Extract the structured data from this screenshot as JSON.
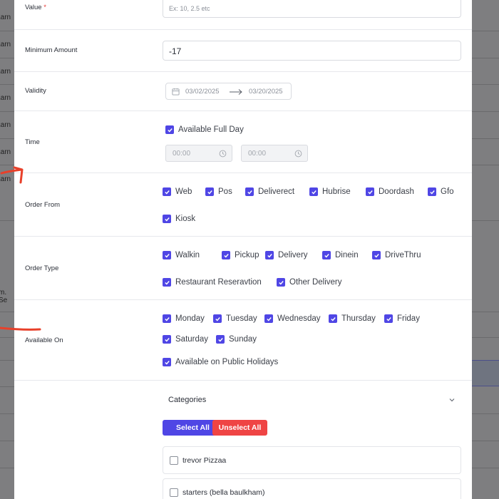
{
  "background": {
    "left_labels": [
      "Earn",
      "Earn",
      "Earn",
      "Earn",
      "Earn",
      "Earn",
      "Earn",
      "m. Se"
    ]
  },
  "form": {
    "value": {
      "label": "Value",
      "required_mark": "*",
      "placeholder": "Ex: 10, 2.5 etc"
    },
    "minimum_amount": {
      "label": "Minimum Amount",
      "value": "-17"
    },
    "validity": {
      "label": "Validity",
      "start": "03/02/2025",
      "end": "03/20/2025"
    },
    "time": {
      "label": "Time",
      "full_day": {
        "label": "Available Full Day",
        "checked": true
      },
      "from": "00:00",
      "to": "00:00"
    },
    "order_from": {
      "label": "Order From",
      "options": [
        {
          "label": "Web",
          "checked": true
        },
        {
          "label": "Pos",
          "checked": true
        },
        {
          "label": "Deliverect",
          "checked": true
        },
        {
          "label": "Hubrise",
          "checked": true
        },
        {
          "label": "Doordash",
          "checked": true
        },
        {
          "label": "Gfo",
          "checked": true
        },
        {
          "label": "Kiosk",
          "checked": true
        }
      ]
    },
    "order_type": {
      "label": "Order Type",
      "options": [
        {
          "label": "Walkin",
          "checked": true
        },
        {
          "label": "Pickup",
          "checked": true
        },
        {
          "label": "Delivery",
          "checked": true
        },
        {
          "label": "Dinein",
          "checked": true
        },
        {
          "label": "DriveThru",
          "checked": true
        },
        {
          "label": "Restaurant Reseravtion",
          "checked": true
        },
        {
          "label": "Other Delivery",
          "checked": true
        }
      ]
    },
    "available_on": {
      "label": "Available On",
      "days": [
        {
          "label": "Monday",
          "checked": true
        },
        {
          "label": "Tuesday",
          "checked": true
        },
        {
          "label": "Wednesday",
          "checked": true
        },
        {
          "label": "Thursday",
          "checked": true
        },
        {
          "label": "Friday",
          "checked": true
        },
        {
          "label": "Saturday",
          "checked": true
        },
        {
          "label": "Sunday",
          "checked": true
        }
      ],
      "public_holidays": {
        "label": "Available on Public Holidays",
        "checked": true
      }
    },
    "categories": {
      "title": "Categories",
      "select_all": "Select All",
      "unselect_all": "Unselect All",
      "items": [
        {
          "label": "trevor Pizzaa",
          "checked": false
        },
        {
          "label": "starters (bella baulkham)",
          "checked": false
        }
      ]
    }
  },
  "colors": {
    "accent": "#4f46e5",
    "danger": "#ef4444",
    "annotation": "#e8402a"
  }
}
